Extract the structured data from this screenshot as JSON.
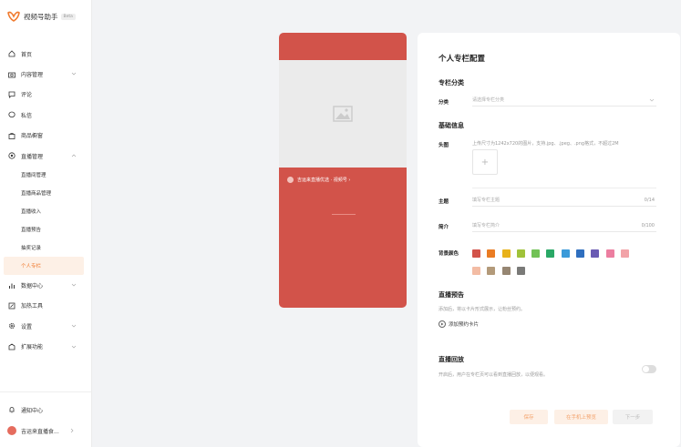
{
  "app": {
    "title": "视频号助手",
    "tag": "Beta",
    "brand_color": "#f07a2e"
  },
  "nav": {
    "home": "首页",
    "content": "内容管理",
    "comments": "评论",
    "messages": "私信",
    "products": "商品橱窗",
    "live": "直播管理",
    "live_sub": [
      "直播间管理",
      "直播商品管理",
      "直播收入",
      "直播预告",
      "抽奖记录",
      "个人专栏"
    ],
    "data": "数据中心",
    "promo": "加热工具",
    "settings": "设置",
    "extend": "扩展功能"
  },
  "sidebar_bottom": {
    "notices": "通知中心",
    "user": "吉运来直播食..."
  },
  "preview": {
    "account_name": "吉运来直播优选 · 视频号 ›",
    "bg_color": "#d2534a"
  },
  "panel": {
    "title": "个人专栏配置",
    "category_section": "专栏分类",
    "category_label": "分类",
    "category_placeholder": "请选择专栏分类",
    "basic_section": "基础信息",
    "avatar_label": "头图",
    "avatar_hint": "上传尺寸为1242x720的图片，支持.jpg、.jpeg、.png格式，不超过2M",
    "upload_plus": "+",
    "topic_label": "主题",
    "topic_placeholder": "填写专栏主题",
    "topic_count": "0/14",
    "intro_label": "简介",
    "intro_placeholder": "填写专栏简介",
    "intro_count": "0/100",
    "bg_label": "背景颜色",
    "colors": [
      "#d2534a",
      "#ea7c23",
      "#e8b21b",
      "#a0c23a",
      "#72c256",
      "#2aa866",
      "#3b9ad9",
      "#2f6fbf",
      "#6a5bb3",
      "#ec7ea0",
      "#f2a3a8",
      "#f3bca4",
      "#b39a7a",
      "#968672",
      "#7a7a78"
    ],
    "notice_section": "直播预告",
    "notice_desc": "添加后，将以卡片形式展示，让粉丝预约。",
    "add_notice": "添加预约卡片",
    "replay_section": "直播回放",
    "replay_desc": "开启后，用户在专栏页可以看到直播回放，以便观看。",
    "btn_save": "保存",
    "btn_phone": "在手机上预览",
    "btn_next": "下一步"
  }
}
